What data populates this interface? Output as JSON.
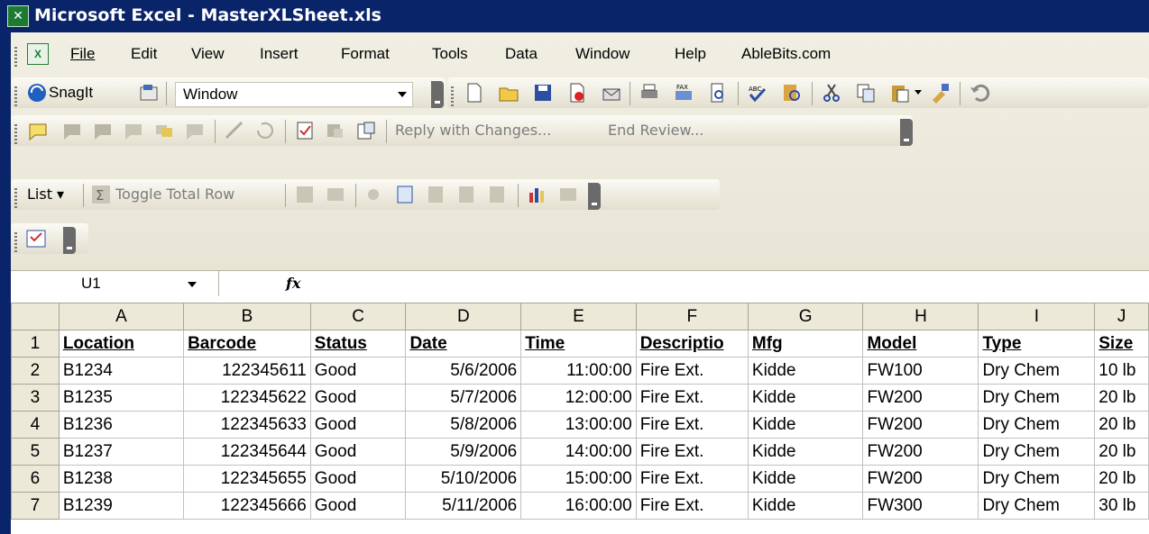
{
  "titlebar": {
    "title": "Microsoft Excel - MasterXLSheet.xls",
    "icon": "excel-icon"
  },
  "menubar": {
    "items": [
      {
        "label": "File"
      },
      {
        "label": "Edit"
      },
      {
        "label": "View"
      },
      {
        "label": "Insert"
      },
      {
        "label": "Format"
      },
      {
        "label": "Tools"
      },
      {
        "label": "Data"
      },
      {
        "label": "Window"
      },
      {
        "label": "Help"
      },
      {
        "label": "AbleBits.com"
      }
    ]
  },
  "snagit": {
    "label": "SnagIt",
    "dropdown_value": "Window"
  },
  "review_bar": {
    "reply_label": "Reply with Changes...",
    "end_label": "End Review..."
  },
  "list_bar": {
    "list_label": "List ▾",
    "toggle_label": "Toggle Total Row"
  },
  "formula": {
    "name_box": "U1",
    "fx_label": "fx",
    "value": ""
  },
  "sheet": {
    "columns": [
      "A",
      "B",
      "C",
      "D",
      "E",
      "F",
      "G",
      "H",
      "I",
      "J"
    ],
    "rows": [
      {
        "n": "1",
        "cells": [
          "Location",
          "Barcode",
          "Status",
          "Date",
          "Time",
          "Descriptio",
          "Mfg",
          "Model",
          "Type",
          "Size"
        ]
      },
      {
        "n": "2",
        "cells": [
          "B1234",
          "122345611",
          "Good",
          "5/6/2006",
          "11:00:00",
          "Fire Ext.",
          "Kidde",
          "FW100",
          "Dry Chem",
          "10 lb"
        ]
      },
      {
        "n": "3",
        "cells": [
          "B1235",
          "122345622",
          "Good",
          "5/7/2006",
          "12:00:00",
          "Fire Ext.",
          "Kidde",
          "FW200",
          "Dry Chem",
          "20 lb"
        ]
      },
      {
        "n": "4",
        "cells": [
          "B1236",
          "122345633",
          "Good",
          "5/8/2006",
          "13:00:00",
          "Fire Ext.",
          "Kidde",
          "FW200",
          "Dry Chem",
          "20 lb"
        ]
      },
      {
        "n": "5",
        "cells": [
          "B1237",
          "122345644",
          "Good",
          "5/9/2006",
          "14:00:00",
          "Fire Ext.",
          "Kidde",
          "FW200",
          "Dry Chem",
          "20 lb"
        ]
      },
      {
        "n": "6",
        "cells": [
          "B1238",
          "122345655",
          "Good",
          "5/10/2006",
          "15:00:00",
          "Fire Ext.",
          "Kidde",
          "FW200",
          "Dry Chem",
          "20 lb"
        ]
      },
      {
        "n": "7",
        "cells": [
          "B1239",
          "122345666",
          "Good",
          "5/11/2006",
          "16:00:00",
          "Fire Ext.",
          "Kidde",
          "FW300",
          "Dry Chem",
          "30 lb"
        ]
      }
    ]
  },
  "colors": {
    "titlebar": "#0a246a",
    "toolbar_bg": "#ece9d8",
    "selected_header": "#ffc875"
  }
}
